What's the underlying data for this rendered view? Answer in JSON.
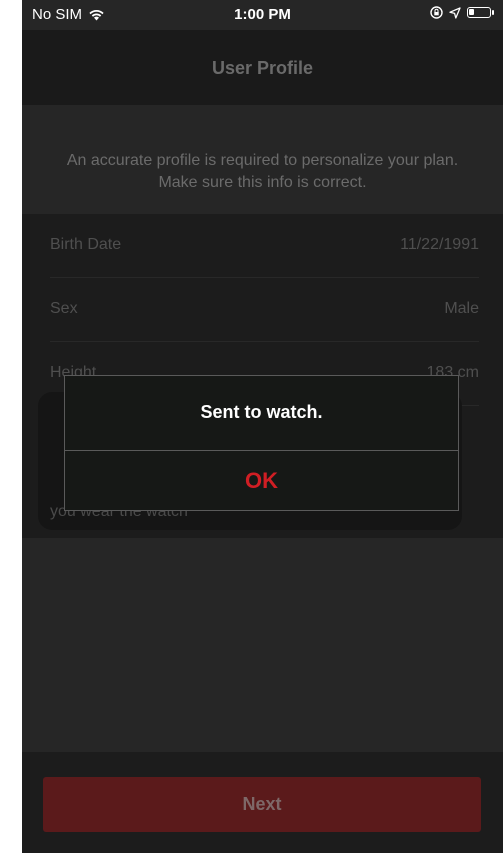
{
  "status_bar": {
    "carrier": "No SIM",
    "time": "1:00 PM",
    "icons": [
      "wifi-icon",
      "location-lock-icon",
      "location-arrow-icon",
      "battery-icon"
    ],
    "battery_level": 0.25
  },
  "nav": {
    "title": "User Profile"
  },
  "info": {
    "text": "An accurate profile is required to personalize your plan. Make sure this info is correct."
  },
  "form": {
    "rows": [
      {
        "label": "Birth Date",
        "value": "11/22/1991"
      },
      {
        "label": "Sex",
        "value": "Male"
      },
      {
        "label": "Height",
        "value": "183 cm"
      }
    ],
    "wrist_fragment": "you wear the watch"
  },
  "alert": {
    "message": "Sent to watch.",
    "ok_label": "OK"
  },
  "footer": {
    "next_label": "Next"
  },
  "colors": {
    "accent_red": "#d01e24",
    "button_red": "#5b1a1b",
    "background": "#262626"
  }
}
